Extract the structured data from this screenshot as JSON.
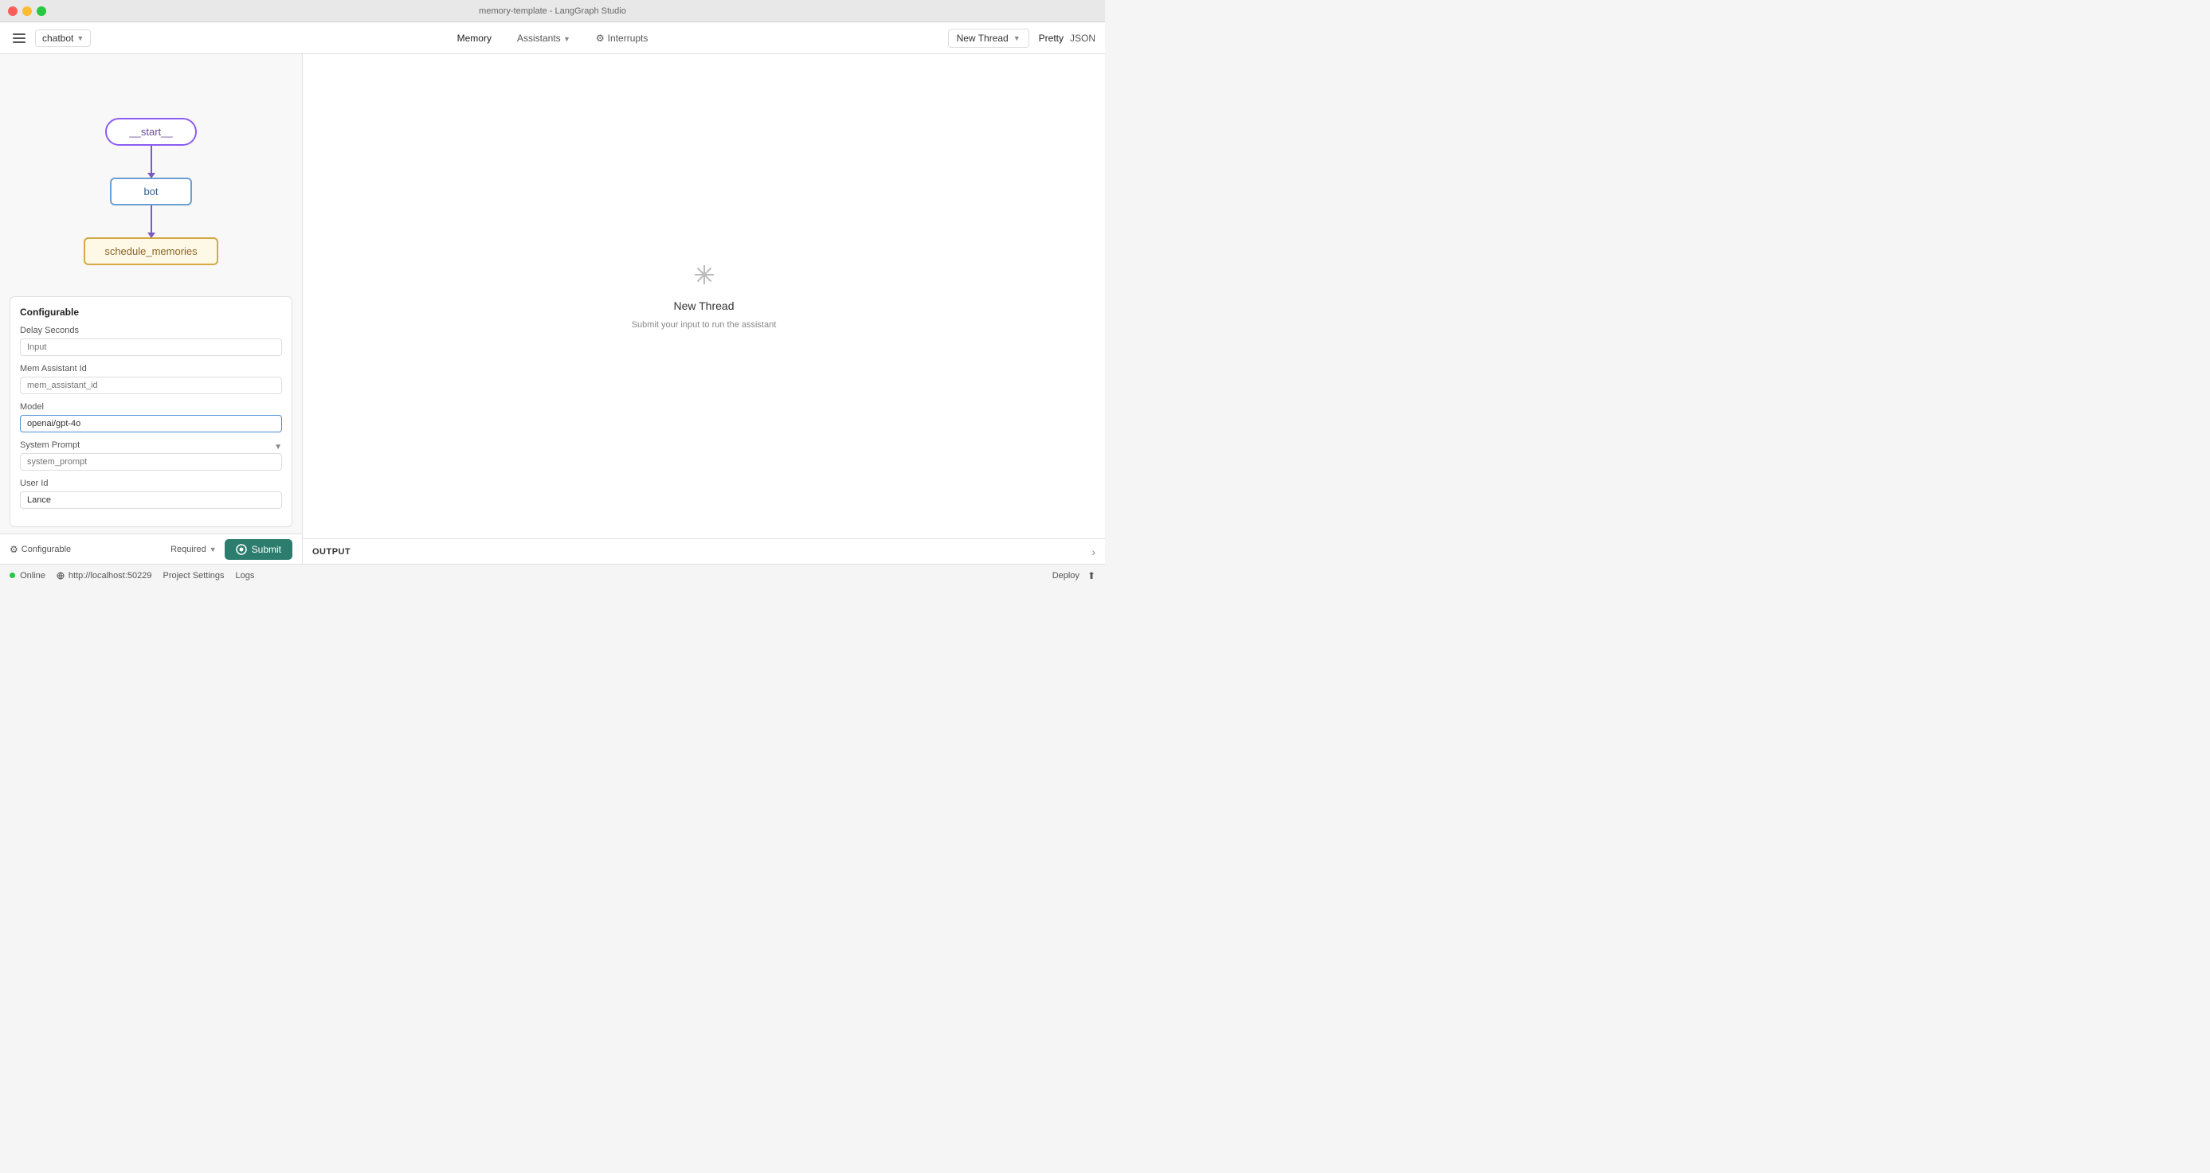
{
  "titlebar": {
    "title": "memory-template - LangGraph Studio"
  },
  "toolbar": {
    "sidebar_toggle_label": "☰",
    "chatbot_label": "chatbot",
    "nav": {
      "memory": "Memory",
      "assistants": "Assistants",
      "interrupts": "Interrupts"
    },
    "new_thread": "New Thread",
    "pretty": "Pretty",
    "json": "JSON"
  },
  "graph": {
    "start_node": "__start__",
    "bot_node": "bot",
    "schedule_node": "schedule_memories"
  },
  "configurable": {
    "title": "Configurable",
    "fields": [
      {
        "label": "Delay Seconds",
        "placeholder": "Input",
        "value": ""
      },
      {
        "label": "Mem Assistant Id",
        "placeholder": "mem_assistant_id",
        "value": ""
      },
      {
        "label": "Model",
        "placeholder": "",
        "value": "openai/gpt-4o"
      },
      {
        "label": "System Prompt",
        "placeholder": "system_prompt",
        "value": ""
      },
      {
        "label": "User Id",
        "placeholder": "",
        "value": "Lance"
      }
    ]
  },
  "bottom_toolbar": {
    "configurable_label": "Configurable",
    "required_label": "Required",
    "submit_label": "Submit"
  },
  "right_panel": {
    "new_thread_icon": "✳",
    "new_thread_heading": "New Thread",
    "new_thread_sub": "Submit your input to run the assistant"
  },
  "output": {
    "label": "OUTPUT",
    "expand_icon": "›"
  },
  "statusbar": {
    "online": "Online",
    "localhost": "http://localhost:50229",
    "project_settings": "Project Settings",
    "logs": "Logs",
    "deploy": "Deploy"
  }
}
